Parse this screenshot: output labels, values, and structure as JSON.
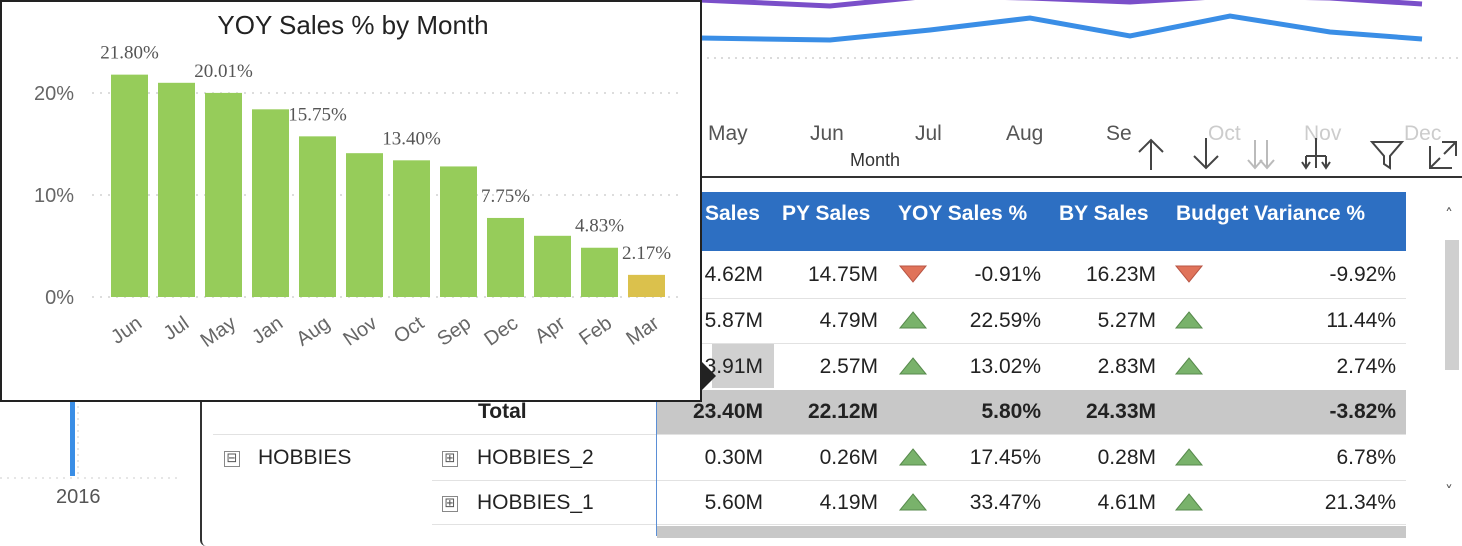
{
  "background_chart": {
    "months": [
      "May",
      "Jun",
      "Jul",
      "Aug",
      "Se",
      "Oct",
      "Nov",
      "Dec"
    ],
    "axis_title": "Month",
    "line_colors": [
      "#7a4fc9",
      "#3a8ee6"
    ]
  },
  "toolbar": {
    "icons": [
      "drill-up-icon",
      "drill-down-icon",
      "expand-next-level-icon",
      "expand-hierarchy-icon",
      "filter-icon",
      "focus-mode-icon"
    ]
  },
  "left_visual": {
    "year": "2016"
  },
  "matrix": {
    "headers": [
      "Sales",
      "PY Sales",
      "YOY Sales %",
      "BY Sales",
      "Budget Variance %"
    ],
    "rows": [
      {
        "sales": "4.62M",
        "py": "14.75M",
        "yoy_dir": "down",
        "yoy": "-0.91%",
        "by": "16.23M",
        "bv_dir": "down",
        "bv": "-9.92%"
      },
      {
        "sales": "5.87M",
        "py": "4.79M",
        "yoy_dir": "up",
        "yoy": "22.59%",
        "by": "5.27M",
        "bv_dir": "up",
        "bv": "11.44%"
      },
      {
        "sales": "3.91M",
        "py": "2.57M",
        "yoy_dir": "up",
        "yoy": "13.02%",
        "by": "2.83M",
        "bv_dir": "up",
        "bv": "2.74%"
      }
    ],
    "total": {
      "label": "Total",
      "sales": "23.40M",
      "py": "22.12M",
      "yoy": "5.80%",
      "by": "24.33M",
      "bv": "-3.82%"
    },
    "group": {
      "label": "HOBBIES",
      "expander": "⊟"
    },
    "sub_rows": [
      {
        "label": "HOBBIES_2",
        "expander": "⊞",
        "sales": "0.30M",
        "py": "0.26M",
        "yoy_dir": "up",
        "yoy": "17.45%",
        "by": "0.28M",
        "bv_dir": "up",
        "bv": "6.78%"
      },
      {
        "label": "HOBBIES_1",
        "expander": "⊞",
        "sales": "5.60M",
        "py": "4.19M",
        "yoy_dir": "up",
        "yoy": "33.47%",
        "by": "4.61M",
        "bv_dir": "up",
        "bv": "21.34%"
      }
    ],
    "colors": {
      "header": "#2d6fc2",
      "up": "#79b26b",
      "down": "#e0735a"
    },
    "scroll_up": "˄",
    "scroll_down": "˅"
  },
  "tooltip": {
    "title": "YOY Sales % by Month"
  },
  "chart_data": {
    "type": "bar",
    "title": "YOY Sales % by Month",
    "categories": [
      "Jun",
      "Jul",
      "May",
      "Jan",
      "Aug",
      "Nov",
      "Oct",
      "Sep",
      "Dec",
      "Apr",
      "Feb",
      "Mar"
    ],
    "values": [
      21.8,
      21.0,
      20.01,
      18.4,
      15.75,
      14.1,
      13.4,
      12.8,
      7.75,
      6.0,
      4.83,
      2.17
    ],
    "data_labels": [
      "21.80%",
      "",
      "20.01%",
      "",
      "15.75%",
      "",
      "13.40%",
      "",
      "7.75%",
      "",
      "4.83%",
      "2.17%"
    ],
    "yticks": [
      "0%",
      "10%",
      "20%"
    ],
    "ytick_values": [
      0,
      10,
      20
    ],
    "ylim": [
      0,
      25
    ],
    "grid": true,
    "colors": [
      "#96cc5a",
      "#96cc5a",
      "#96cc5a",
      "#96cc5a",
      "#96cc5a",
      "#96cc5a",
      "#96cc5a",
      "#96cc5a",
      "#96cc5a",
      "#96cc5a",
      "#96cc5a",
      "#dbc14c"
    ]
  }
}
